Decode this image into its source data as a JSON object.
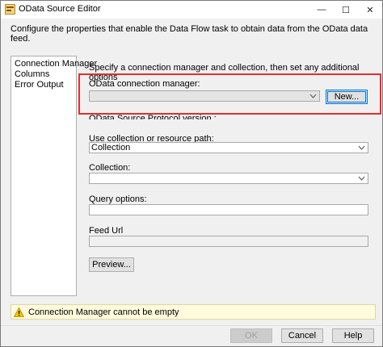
{
  "window": {
    "title": "OData Source Editor",
    "minimize_glyph": "—",
    "maximize_glyph": "☐",
    "close_glyph": "✕"
  },
  "description": "Configure the properties that enable the Data Flow task to obtain data from the OData data feed.",
  "nav": {
    "items": [
      {
        "label": "Connection Manager"
      },
      {
        "label": "Columns"
      },
      {
        "label": "Error Output"
      }
    ]
  },
  "form": {
    "instructions": "Specify a connection manager and collection, then set any additional options",
    "connection_manager_label": "OData connection manager:",
    "connection_manager_value": "",
    "new_button": "New...",
    "protocol_label": "OData Source Protocol version :",
    "use_collection_label": "Use collection or resource path:",
    "use_collection_value": "Collection",
    "collection_label": "Collection:",
    "collection_value": "",
    "query_options_label": "Query options:",
    "query_options_value": "",
    "feed_url_label": "Feed Url",
    "feed_url_value": "",
    "preview_button": "Preview..."
  },
  "status": {
    "message": "Connection Manager cannot be empty",
    "icon": "warning-icon"
  },
  "footer": {
    "ok": "OK",
    "cancel": "Cancel",
    "help": "Help"
  },
  "colors": {
    "highlight": "#e03030",
    "focus": "#0078d7",
    "warning_bg": "#fffbdc"
  }
}
